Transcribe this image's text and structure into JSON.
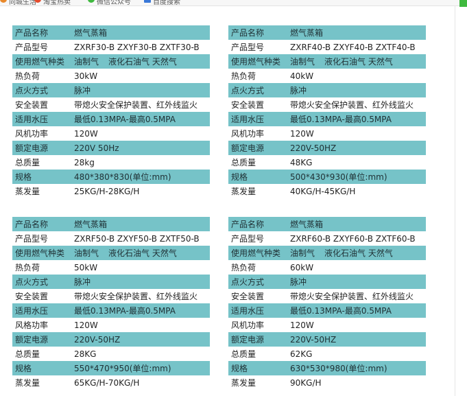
{
  "browser": {
    "bookmarks": [
      "同城生活",
      "淘宝热卖",
      "微信公众号",
      "百度搜索"
    ],
    "colors": {
      "bookmark_1": "#e9892b",
      "bookmark_2": "#e64b2c",
      "bookmark_3": "#3fb93f",
      "bookmark_4": "#3a78d8"
    }
  },
  "colors": {
    "header_row": "#76c3c8",
    "plain_row": "#ffffff",
    "text": "#222222"
  },
  "products": [
    {
      "rows": [
        {
          "key": "产品名称",
          "val": "燃气蒸箱"
        },
        {
          "key": "产品型号",
          "val": "ZXRF30-B  ZXYF30-B  ZXTF30-B"
        },
        {
          "key": "使用燃气种类",
          "val": [
            "油制气",
            "液化石油气  天然气"
          ]
        },
        {
          "key": "热负荷",
          "val": "30kW"
        },
        {
          "key": "点火方式",
          "val": "脉冲"
        },
        {
          "key": "安全装置",
          "val": "带熄火安全保护装置、红外线监火"
        },
        {
          "key": "适用水压",
          "val": "最低0.13MPA-最高0.5MPA"
        },
        {
          "key": "风机功率",
          "val": "120W"
        },
        {
          "key": "额定电源",
          "val": "220V 50Hz"
        },
        {
          "key": "总质量",
          "val": "28kg"
        },
        {
          "key": "规格",
          "val": "480*380*830(单位:mm)"
        },
        {
          "key": "蒸发量",
          "val": "25KG/H-28KG/H"
        }
      ]
    },
    {
      "rows": [
        {
          "key": "产品名称",
          "val": "燃气蒸箱"
        },
        {
          "key": "产品型号",
          "val": "ZXRF40-B  ZXYF40-B  ZXTF40-B"
        },
        {
          "key": "使用燃气种类",
          "val": [
            "油制气",
            "液化石油气  天然气"
          ]
        },
        {
          "key": "热负荷",
          "val": "40kW"
        },
        {
          "key": "点火方式",
          "val": "脉冲"
        },
        {
          "key": "安全装置",
          "val": "带熄火安全保护装置、红外线监火"
        },
        {
          "key": "适用水压",
          "val": "最低0.13MPA-最高0.5MPA"
        },
        {
          "key": "风机功率",
          "val": "120W"
        },
        {
          "key": "额定电源",
          "val": "220V-50HZ"
        },
        {
          "key": "总质量",
          "val": "48KG"
        },
        {
          "key": "规格",
          "val": "500*430*930(单位:mm)"
        },
        {
          "key": "蒸发量",
          "val": "40KG/H-45KG/H"
        }
      ]
    },
    {
      "rows": [
        {
          "key": "产品名称",
          "val": "燃气蒸箱"
        },
        {
          "key": "产品型号",
          "val": "ZXRF50-B  ZXYF50-B  ZXTF50-B"
        },
        {
          "key": "使用燃气种类",
          "val": [
            "油制气",
            "液化石油气  天然气"
          ]
        },
        {
          "key": "热负荷",
          "val": "50kW"
        },
        {
          "key": "点火方式",
          "val": "脉冲"
        },
        {
          "key": "安全装置",
          "val": "带熄火安全保护装置、红外线监火"
        },
        {
          "key": "适用水压",
          "val": "最低0.13MPA-最高0.5MPA"
        },
        {
          "key": "风格功率",
          "val": "120W"
        },
        {
          "key": "额定电源",
          "val": "220V-50HZ"
        },
        {
          "key": "总质量",
          "val": "28KG"
        },
        {
          "key": "规格",
          "val": "550*470*950(单位:mm)"
        },
        {
          "key": "蒸发量",
          "val": "65KG/H-70KG/H"
        }
      ]
    },
    {
      "rows": [
        {
          "key": "产品名称",
          "val": "燃气蒸箱"
        },
        {
          "key": "产品型号",
          "val": "ZXRF60-B  ZXYF60-B  ZXTF60-B"
        },
        {
          "key": "使用燃气种类",
          "val": [
            "油制气",
            "液化石油气  天然气"
          ]
        },
        {
          "key": "热负荷",
          "val": "60kW"
        },
        {
          "key": "点火方式",
          "val": "脉冲"
        },
        {
          "key": "安全装置",
          "val": "带熄火安全保护装置、红外线监火"
        },
        {
          "key": "适用水压",
          "val": "最低0.13MPA-最高0.5MPA"
        },
        {
          "key": "风机功率",
          "val": "120W"
        },
        {
          "key": "额定电源",
          "val": "220V-50HZ"
        },
        {
          "key": "总质量",
          "val": "62KG"
        },
        {
          "key": "规格",
          "val": "630*530*980(单位:mm)"
        },
        {
          "key": "蒸发量",
          "val": "90KG/H"
        }
      ]
    }
  ]
}
